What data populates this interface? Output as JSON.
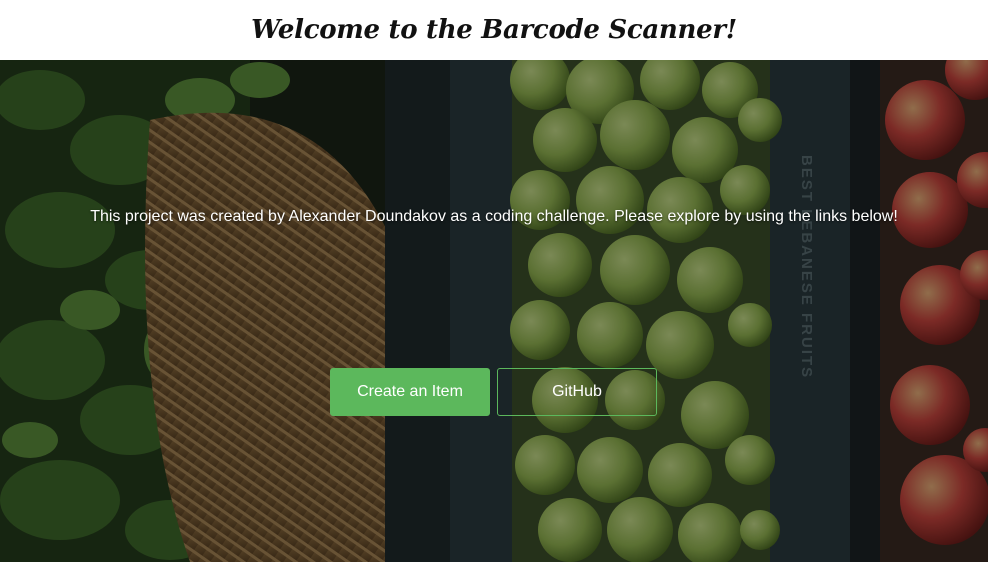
{
  "header": {
    "title": "Welcome to the Barcode Scanner!"
  },
  "hero": {
    "tagline": "This project was created by Alexander Doundakov as a coding challenge. Please explore by using the links below!",
    "crate_text": "BEST LEBANESE FRUITS",
    "overlay_color": "#000000",
    "buttons": {
      "create_label": "Create an Item",
      "github_label": "GitHub"
    }
  },
  "colors": {
    "accent_green": "#5cb85c",
    "background": "#ffffff",
    "title_text": "#111111",
    "hero_text": "#ffffff"
  }
}
